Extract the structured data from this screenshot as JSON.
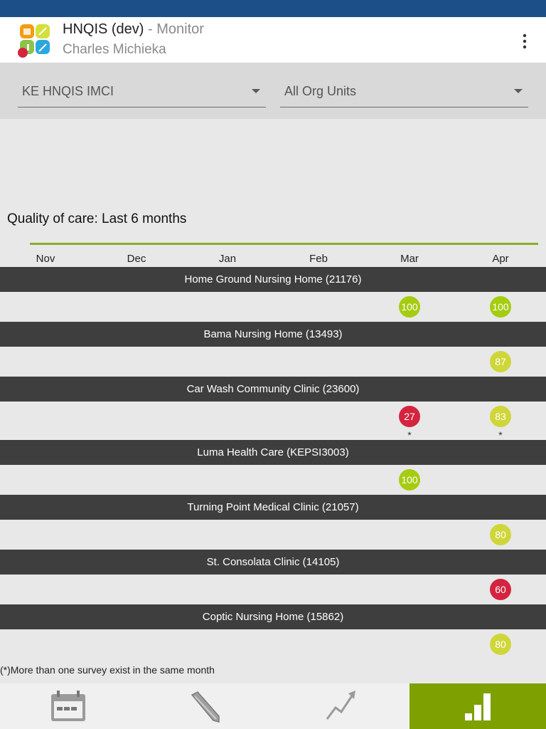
{
  "app": {
    "title": "HNQIS (dev)",
    "title_suffix": " - Monitor",
    "user": "Charles Michieka"
  },
  "filters": {
    "program": "KE HNQIS IMCI",
    "org_unit": "All Org Units"
  },
  "monitor": {
    "title": "Quality of care: Last 6 months",
    "months": [
      "Nov",
      "Dec",
      "Jan",
      "Feb",
      "Mar",
      "Apr"
    ],
    "facilities": [
      {
        "name": "Home Ground Nursing Home (21176)",
        "scores": [
          {
            "month": "Mar",
            "value": "100",
            "level": "high"
          },
          {
            "month": "Apr",
            "value": "100",
            "level": "high"
          }
        ]
      },
      {
        "name": "Bama Nursing Home (13493)",
        "scores": [
          {
            "month": "Apr",
            "value": "87",
            "level": "mid"
          }
        ]
      },
      {
        "name": "Car Wash Community Clinic (23600)",
        "scores": [
          {
            "month": "Mar",
            "value": "27",
            "level": "low",
            "marker": "*"
          },
          {
            "month": "Apr",
            "value": "83",
            "level": "mid",
            "marker": "*"
          }
        ]
      },
      {
        "name": "Luma Health Care (KEPSI3003)",
        "scores": [
          {
            "month": "Mar",
            "value": "100",
            "level": "high"
          }
        ]
      },
      {
        "name": "Turning Point Medical Clinic (21057)",
        "scores": [
          {
            "month": "Apr",
            "value": "80",
            "level": "mid"
          }
        ]
      },
      {
        "name": "St. Consolata Clinic (14105)",
        "scores": [
          {
            "month": "Apr",
            "value": "60",
            "level": "low"
          }
        ]
      },
      {
        "name": "Coptic Nursing Home (15862)",
        "scores": [
          {
            "month": "Apr",
            "value": "80",
            "level": "mid"
          }
        ]
      }
    ],
    "footnote": "(*)More than one survey exist in the same month"
  },
  "colors": {
    "high": "#a5cc10",
    "mid": "#cfd63a",
    "low": "#d4243f",
    "accent": "#7ea000",
    "status_bar": "#1c4f88"
  },
  "bottom_nav": [
    {
      "icon": "calendar-icon",
      "active": false
    },
    {
      "icon": "pencil-icon",
      "active": false
    },
    {
      "icon": "trend-arrow-icon",
      "active": false
    },
    {
      "icon": "bar-chart-icon",
      "active": true
    }
  ]
}
